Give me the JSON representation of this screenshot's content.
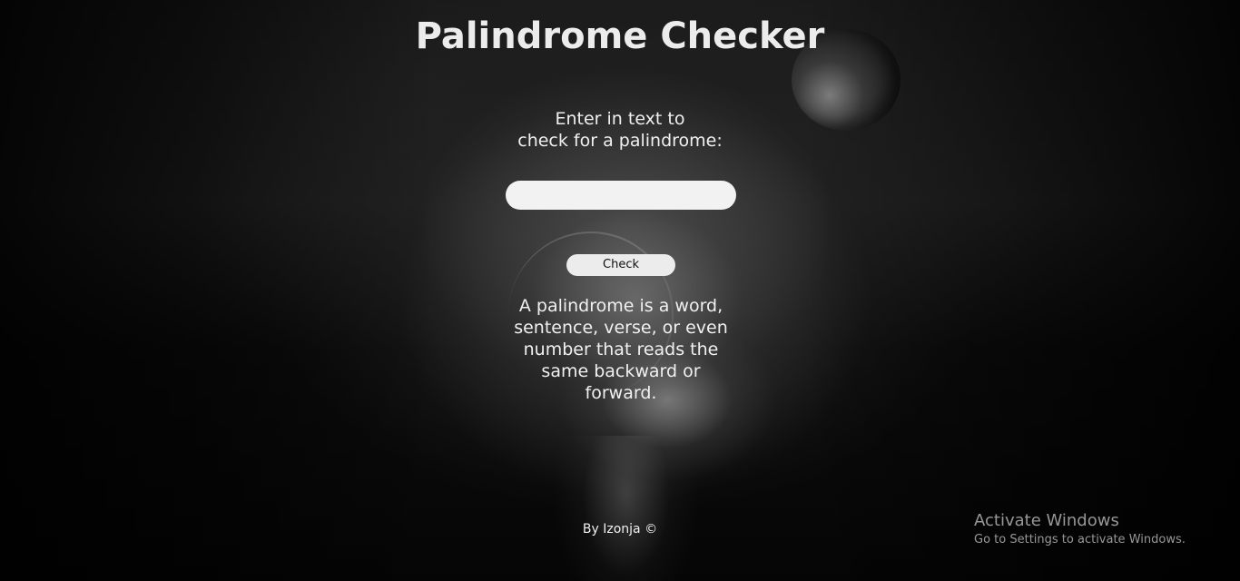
{
  "header": {
    "title": "Palindrome Checker"
  },
  "form": {
    "prompt_line1": "Enter in text to",
    "prompt_line2": "check for a palindrome:",
    "input_value": "",
    "check_label": "Check"
  },
  "info": {
    "description": "A palindrome is a word, sentence, verse, or even number that reads the same backward or forward."
  },
  "footer": {
    "credit": "By Izonja ©"
  },
  "os_watermark": {
    "title": "Activate Windows",
    "subtitle": "Go to Settings to activate Windows."
  }
}
